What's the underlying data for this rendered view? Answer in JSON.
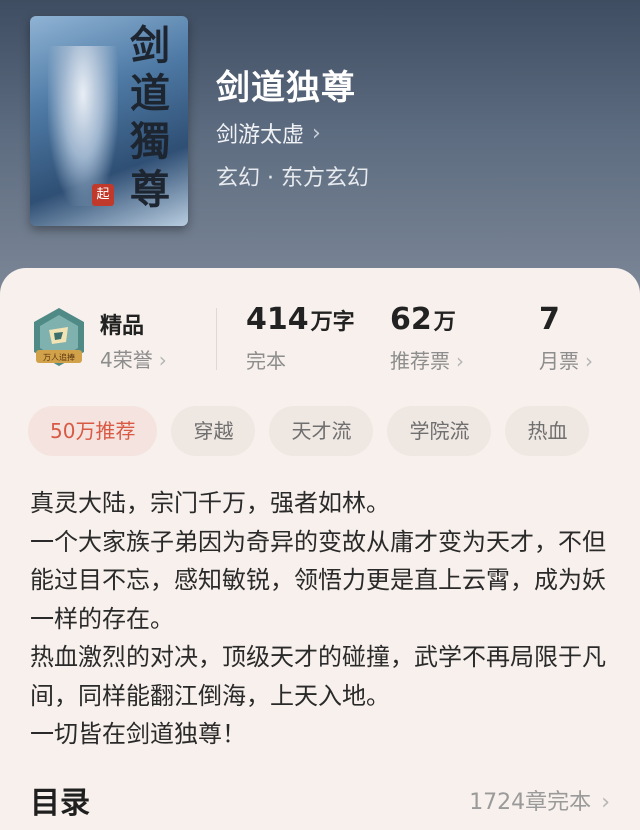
{
  "book": {
    "title": "剑道独尊",
    "author": "剑游太虚",
    "genre": "玄幻 · 东方玄幻",
    "cover_text": "剑道獨尊",
    "cover_seal": "起"
  },
  "honor": {
    "label": "精品",
    "sub": "4荣誉",
    "badge_text": "万人追捧"
  },
  "stats": [
    {
      "value": "414",
      "unit": "万字",
      "label": "完本"
    },
    {
      "value": "62",
      "unit": "万",
      "label": "推荐票"
    },
    {
      "value": "7",
      "unit": "",
      "label": "月票"
    }
  ],
  "tags": [
    "50万推荐",
    "穿越",
    "天才流",
    "学院流",
    "热血"
  ],
  "description": [
    "真灵大陆，宗门千万，强者如林。",
    "一个大家族子弟因为奇异的变故从庸才变为天才，不但能过目不忘，感知敏锐，领悟力更是直上云霄，成为妖一样的存在。",
    "热血激烈的对决，顶级天才的碰撞，武学不再局限于凡间，同样能翻江倒海，上天入地。",
    "一切皆在剑道独尊！"
  ],
  "toc": {
    "title": "目录",
    "count": "1724章完本"
  },
  "colors": {
    "accent": "#d85a45",
    "panel_bg": "#f7f0ec"
  }
}
